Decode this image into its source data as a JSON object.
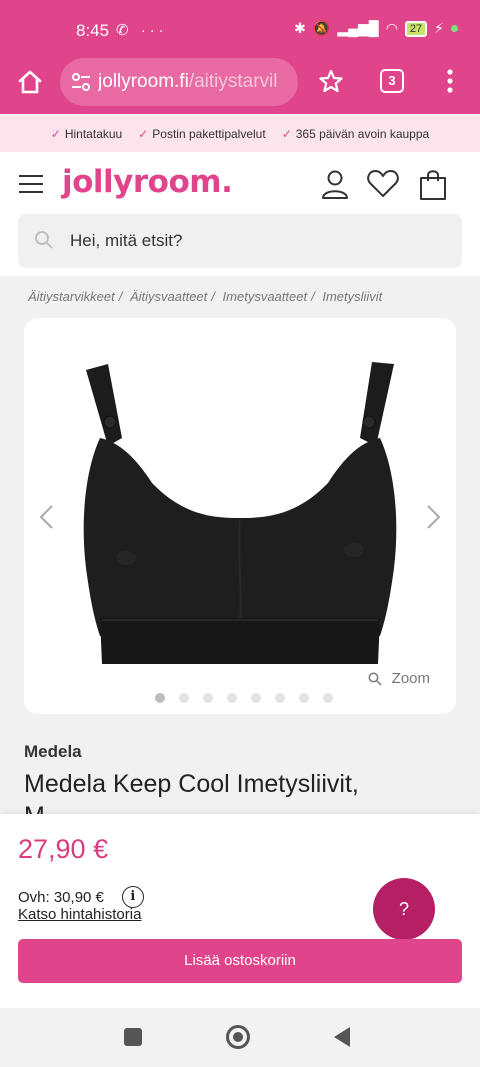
{
  "status_bar": {
    "time": "8:45",
    "left_icons": "✆ ···",
    "battery": "27"
  },
  "browser": {
    "url_domain": "jollyroom.fi",
    "url_path": "/aitiystarvil",
    "tab_count": "3"
  },
  "usp": [
    {
      "label": "Hintatakuu"
    },
    {
      "label": "Postin pakettipalvelut"
    },
    {
      "label": "365 päivän avoin kauppa"
    }
  ],
  "header": {
    "logo": "jollyroom.",
    "search_placeholder": "Hei, mitä etsit?"
  },
  "breadcrumb": [
    "Äitiystarvikkeet",
    "Äitiysvaatteet",
    "Imetysvaatteet",
    "Imetysliivit"
  ],
  "breadcrumb_sep": "/",
  "gallery": {
    "zoom_label": "Zoom",
    "image_count": 8,
    "active_index": 0
  },
  "product": {
    "brand": "Medela",
    "title": "Medela Keep Cool Imetysliivit,",
    "title_cont": "M"
  },
  "buybox": {
    "price": "27,90 €",
    "ovh": "Ovh: 30,90 €",
    "history_link": "Katso hintahistoria",
    "help_label": "?",
    "cart_button": "Lisää ostoskoriin"
  },
  "colors": {
    "brand_pink": "#e0458b",
    "price_pink": "#d93d7e",
    "help_purple": "#b51f63"
  }
}
